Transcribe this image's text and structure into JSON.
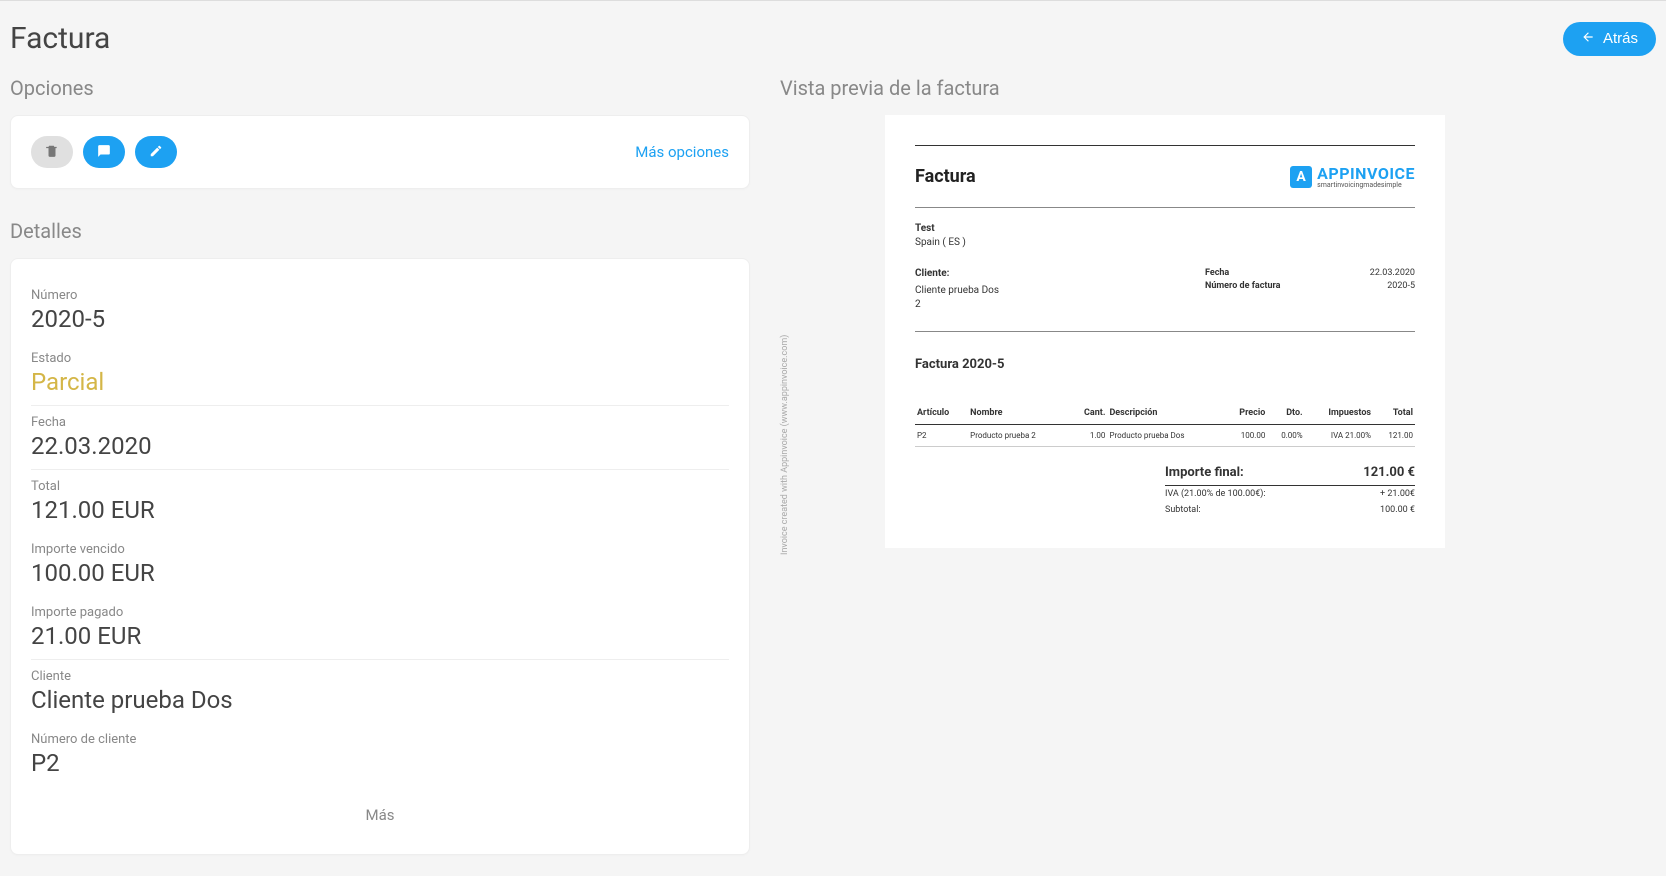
{
  "header": {
    "title": "Factura",
    "back_label": "Atrás"
  },
  "options": {
    "section_title": "Opciones",
    "more_options": "Más opciones"
  },
  "details": {
    "section_title": "Detalles",
    "number_label": "Número",
    "number_value": "2020-5",
    "status_label": "Estado",
    "status_value": "Parcial",
    "date_label": "Fecha",
    "date_value": "22.03.2020",
    "total_label": "Total",
    "total_value": "121.00 EUR",
    "due_label": "Importe vencido",
    "due_value": "100.00 EUR",
    "paid_label": "Importe pagado",
    "paid_value": "21.00 EUR",
    "client_label": "Cliente",
    "client_value": "Cliente prueba Dos",
    "client_number_label": "Número de cliente",
    "client_number_value": "P2",
    "more": "Más"
  },
  "preview": {
    "section_title": "Vista previa de la factura",
    "vertical_note": "Invoice created with Appinvoice (www.appinvoice.com)",
    "title": "Factura",
    "logo_text": "APPINVOICE",
    "logo_sub": "smartinvoicingmadesimple",
    "sender_name": "Test",
    "sender_country": "Spain ( ES )",
    "client_heading": "Cliente:",
    "client_name": "Cliente prueba Dos",
    "client_number": "2",
    "meta_date_label": "Fecha",
    "meta_date_value": "22.03.2020",
    "meta_invnum_label": "Número de factura",
    "meta_invnum_value": "2020-5",
    "invoice_heading": "Factura 2020-5",
    "table": {
      "headers": {
        "article": "Artículo",
        "name": "Nombre",
        "qty": "Cant.",
        "desc": "Descripción",
        "price": "Precio",
        "discount": "Dto.",
        "tax": "Impuestos",
        "total": "Total"
      },
      "row": {
        "article": "P2",
        "name": "Producto prueba 2",
        "qty": "1.00",
        "desc": "Producto prueba Dos",
        "price": "100.00",
        "discount": "0.00%",
        "tax": "IVA 21.00%",
        "total": "121.00"
      }
    },
    "totals": {
      "final_label": "Importe final:",
      "final_value": "121.00 €",
      "iva_label": "IVA (21.00% de 100.00€):",
      "iva_value": "+ 21.00€",
      "subtotal_label": "Subtotal:",
      "subtotal_value": "100.00 €"
    }
  }
}
